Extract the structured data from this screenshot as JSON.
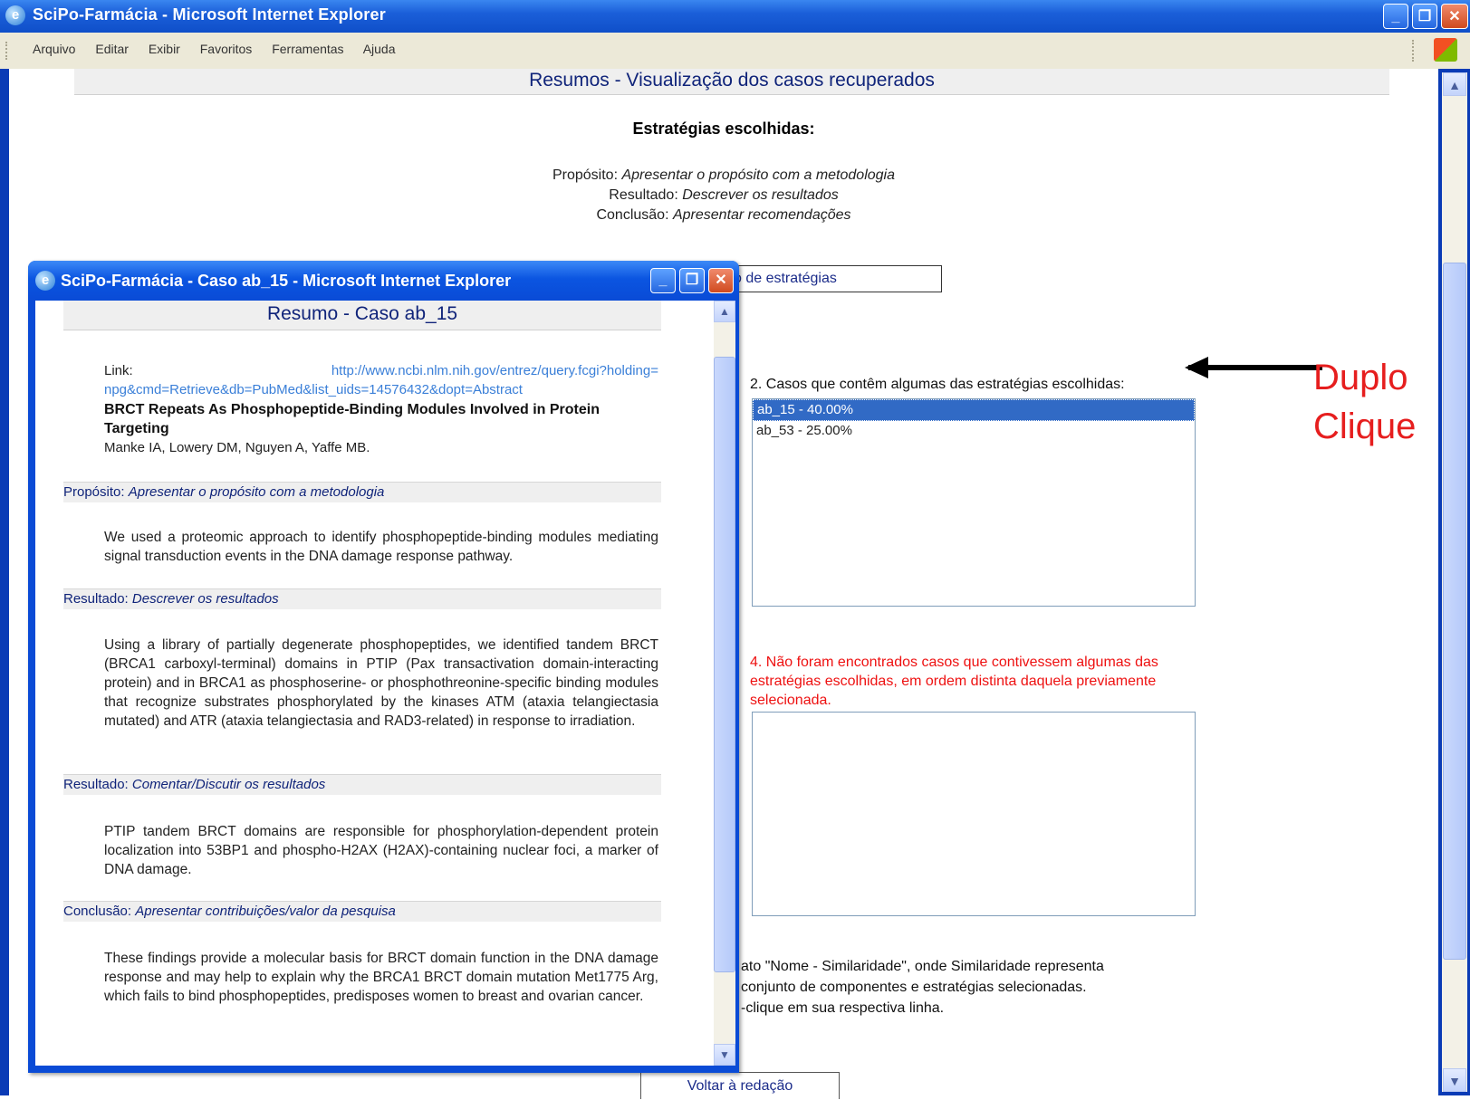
{
  "main_window": {
    "title": "SciPo-Farmácia - Microsoft Internet Explorer",
    "controls": {
      "minimize": "_",
      "maximize": "❐",
      "close": "✕"
    },
    "menu": [
      "Arquivo",
      "Editar",
      "Exibir",
      "Favoritos",
      "Ferramentas",
      "Ajuda"
    ]
  },
  "page": {
    "header": "Resumos - Visualização dos casos recuperados",
    "strategies_title": "Estratégias escolhidas:",
    "strategies": [
      {
        "label": "Propósito:",
        "value": "Apresentar o propósito com a metodologia"
      },
      {
        "label": "Resultado:",
        "value": "Descrever os resultados"
      },
      {
        "label": "Conclusão:",
        "value": "Apresentar recomendações"
      }
    ],
    "strategy_box_text": "o de estratégias",
    "section2_label": "2. Casos que contêm algumas das estratégias escolhidas:",
    "section2_options": [
      {
        "text": "ab_15 - 40.00%",
        "selected": true
      },
      {
        "text": "ab_53 - 25.00%",
        "selected": false
      }
    ],
    "section4_label": "4. Não foram encontrados casos que contivessem algumas das estratégias escolhidas, em ordem distinta daquela previamente selecionada.",
    "footnote_lines": [
      "ato \"Nome - Similaridade\", onde Similaridade representa",
      "conjunto de componentes e estratégias selecionadas.",
      "-clique em sua respectiva linha."
    ],
    "back_button": "Voltar à redação"
  },
  "annotation": {
    "line1": "Duplo",
    "line2": "Clique",
    "color": "#e61e1e"
  },
  "popup": {
    "title": "SciPo-Farmácia - Caso ab_15 - Microsoft Internet Explorer",
    "header": "Resumo - Caso ab_15",
    "link_label": "Link:",
    "link_url": "http://www.ncbi.nlm.nih.gov/entrez/query.fcgi?holding=npg&cmd=Retrieve&db=PubMed&list_uids=14576432&dopt=Abstract",
    "article_title": "BRCT Repeats As Phosphopeptide-Binding Modules Involved in Protein Targeting",
    "authors": "Manke IA, Lowery DM, Nguyen A, Yaffe MB.",
    "sections": [
      {
        "label": "Propósito:",
        "strategy": "Apresentar o propósito com a metodologia",
        "text": "We used a proteomic approach to identify phosphopeptide-binding modules mediating signal transduction events in the DNA damage response pathway."
      },
      {
        "label": "Resultado:",
        "strategy": "Descrever os resultados",
        "text": "Using a library of partially degenerate phosphopeptides, we identified tandem BRCT (BRCA1 carboxyl-terminal) domains in PTIP (Pax transactivation domain-interacting protein) and in BRCA1 as phosphoserine- or phosphothreonine-specific binding modules that recognize substrates phosphorylated by the kinases ATM (ataxia telangiectasia mutated) and ATR (ataxia telangiectasia and RAD3-related) in response to irradiation."
      },
      {
        "label": "Resultado:",
        "strategy": "Comentar/Discutir os resultados",
        "text": "PTIP tandem BRCT domains are responsible for phosphorylation-dependent protein localization into 53BP1 and phospho-H2AX (H2AX)-containing nuclear foci, a marker of DNA damage."
      },
      {
        "label": "Conclusão:",
        "strategy": "Apresentar contribuições/valor da pesquisa",
        "text": "These findings provide a molecular basis for BRCT domain function in the DNA damage response and may help to explain why the BRCA1 BRCT domain mutation Met1775 Arg, which fails to bind phosphopeptides, predisposes women to breast and ovarian cancer."
      }
    ]
  }
}
